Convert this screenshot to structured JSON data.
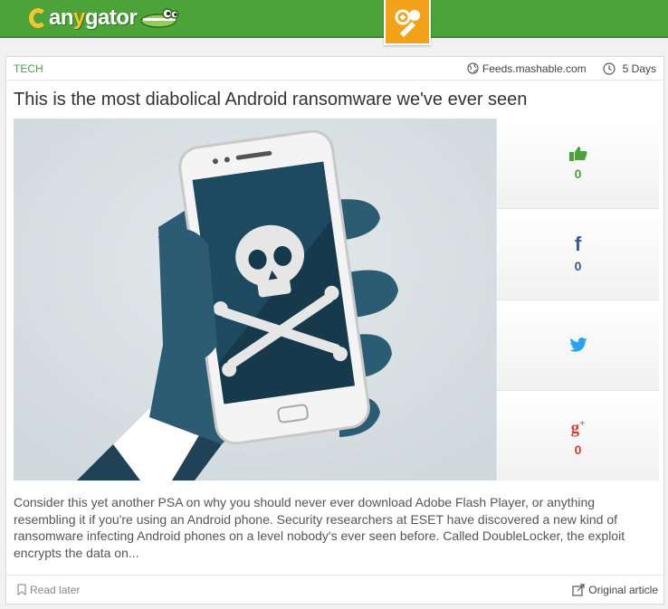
{
  "header": {
    "logo": {
      "prefix": "an",
      "middle": "y",
      "rest": "gator"
    },
    "action_icon": "discover-icon"
  },
  "article": {
    "category": "TECH",
    "source": "Feeds.mashable.com",
    "age": "5 Days",
    "title": "This is the most diabolical Android ransomware we've ever seen",
    "image_alt_icon": "phone-skull-illustration",
    "excerpt": "Consider this yet another PSA on why you should never ever download Adobe Flash Player, or anything resembling it if you're using an Android phone. Security researchers at ESET have discovered a new kind of ransomware infecting Android phones on a level nobody's ever seen before. Called DoubleLocker, the exploit encrypts the data on...",
    "read_later": "Read later",
    "original_article": "Original article"
  },
  "social": {
    "like_count": "0",
    "facebook_count": "0",
    "google_count": "0"
  },
  "colors": {
    "brand_green": "#4ba33a",
    "accent_orange": "#f5a21b",
    "facebook_blue": "#3b5998",
    "twitter_blue": "#2aa3ef",
    "google_red": "#d23f31"
  }
}
